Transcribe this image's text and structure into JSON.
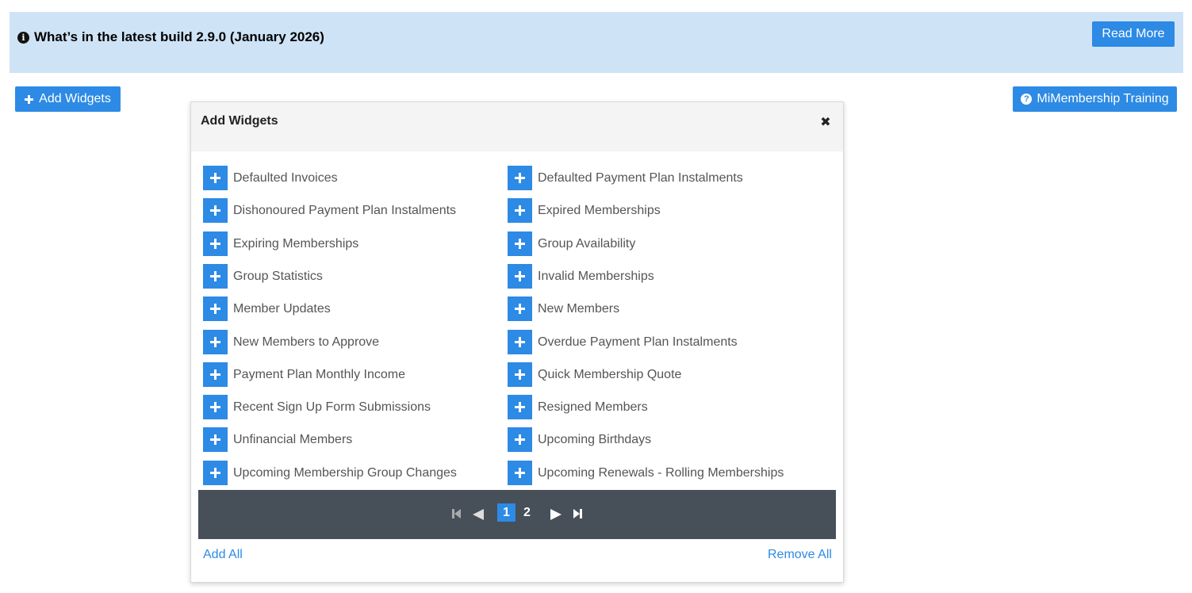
{
  "banner": {
    "title": "What’s in the latest build 2.9.0 (January 2026)",
    "info_icon": "info-circle-icon",
    "read_more_label": "Read More"
  },
  "toolbar": {
    "add_widgets_label": "Add Widgets",
    "training_label": "MiMembership Training",
    "training_icon": "question-circle-icon"
  },
  "modal": {
    "title": "Add Widgets",
    "close_icon": "close-icon",
    "widgets_left": [
      {
        "label": "Defaulted Invoices"
      },
      {
        "label": "Dishonoured Payment Plan Instalments"
      },
      {
        "label": "Expiring Memberships"
      },
      {
        "label": "Group Statistics"
      },
      {
        "label": "Member Updates"
      },
      {
        "label": "New Members to Approve"
      },
      {
        "label": "Payment Plan Monthly Income"
      },
      {
        "label": "Recent Sign Up Form Submissions"
      },
      {
        "label": "Unfinancial Members"
      },
      {
        "label": "Upcoming Membership Group Changes"
      }
    ],
    "widgets_right": [
      {
        "label": "Defaulted Payment Plan Instalments"
      },
      {
        "label": "Expired Memberships"
      },
      {
        "label": "Group Availability"
      },
      {
        "label": "Invalid Memberships"
      },
      {
        "label": "New Members"
      },
      {
        "label": "Overdue Payment Plan Instalments"
      },
      {
        "label": "Quick Membership Quote"
      },
      {
        "label": "Resigned Members"
      },
      {
        "label": "Upcoming Birthdays"
      },
      {
        "label": "Upcoming Renewals - Rolling Memberships"
      }
    ],
    "pagination": {
      "pages": [
        "1",
        "2"
      ],
      "current_page": "1"
    },
    "add_all_label": "Add All",
    "remove_all_label": "Remove All"
  },
  "colors": {
    "accent": "#2d8ae5",
    "banner_bg": "#cfe3f7",
    "pager_bg": "#474f59"
  }
}
